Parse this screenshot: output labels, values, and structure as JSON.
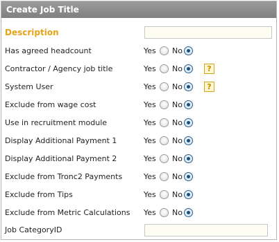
{
  "panel": {
    "title": "Create Job Title"
  },
  "radio_labels": {
    "yes": "Yes",
    "no": "No"
  },
  "help_icon_text": "?",
  "fields": {
    "description": {
      "label": "Description",
      "value": ""
    },
    "job_category_id": {
      "label": "Job CategoryID",
      "value": ""
    }
  },
  "options": [
    {
      "label": "Has agreed headcount",
      "selected": "No",
      "help": false
    },
    {
      "label": "Contractor / Agency job title",
      "selected": "No",
      "help": true
    },
    {
      "label": "System User",
      "selected": "No",
      "help": true
    },
    {
      "label": "Exclude from wage cost",
      "selected": "No",
      "help": false
    },
    {
      "label": "Use in recruitment module",
      "selected": "No",
      "help": false
    },
    {
      "label": "Display Additional Payment 1",
      "selected": "No",
      "help": false
    },
    {
      "label": "Display Additional Payment 2",
      "selected": "No",
      "help": false
    },
    {
      "label": "Exclude from Tronc2 Payments",
      "selected": "No",
      "help": false
    },
    {
      "label": "Exclude from Tips",
      "selected": "No",
      "help": false
    },
    {
      "label": "Exclude from Metric Calculations",
      "selected": "No",
      "help": false
    }
  ]
}
